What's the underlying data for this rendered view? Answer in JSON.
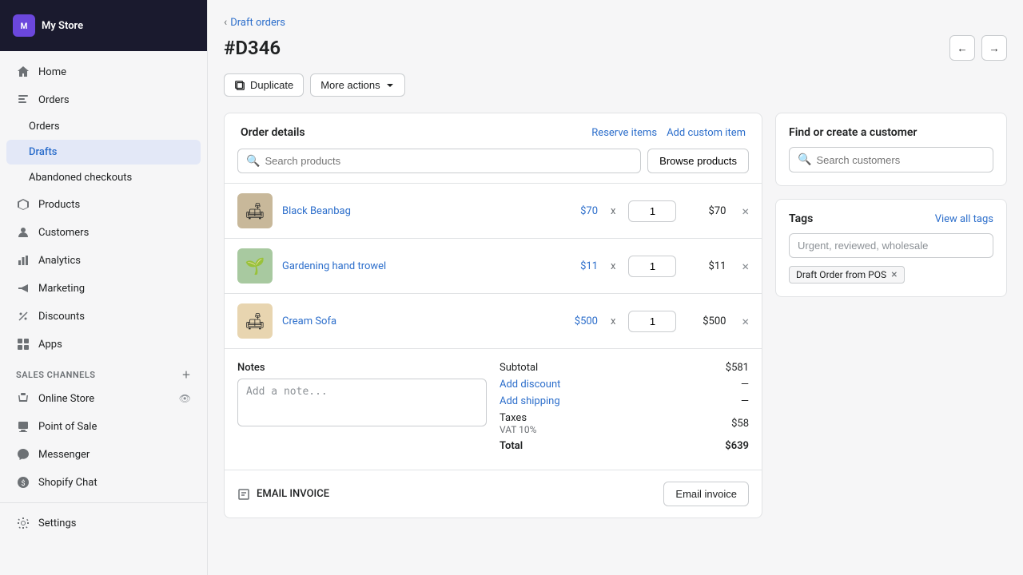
{
  "sidebar": {
    "shop": {
      "name": "My Store",
      "initial": "M"
    },
    "nav_items": [
      {
        "id": "home",
        "label": "Home",
        "icon": "home"
      },
      {
        "id": "orders",
        "label": "Orders",
        "icon": "orders"
      },
      {
        "id": "orders-sub",
        "label": "Orders",
        "icon": null,
        "sub": true
      },
      {
        "id": "drafts-sub",
        "label": "Drafts",
        "icon": null,
        "sub": true,
        "active": true
      },
      {
        "id": "abandoned-sub",
        "label": "Abandoned checkouts",
        "icon": null,
        "sub": true
      },
      {
        "id": "products",
        "label": "Products",
        "icon": "products"
      },
      {
        "id": "customers",
        "label": "Customers",
        "icon": "customers"
      },
      {
        "id": "analytics",
        "label": "Analytics",
        "icon": "analytics"
      },
      {
        "id": "marketing",
        "label": "Marketing",
        "icon": "marketing"
      },
      {
        "id": "discounts",
        "label": "Discounts",
        "icon": "discounts"
      },
      {
        "id": "apps",
        "label": "Apps",
        "icon": "apps"
      }
    ],
    "sales_channels_label": "SALES CHANNELS",
    "sales_channels": [
      {
        "id": "online-store",
        "label": "Online Store",
        "icon": "store"
      },
      {
        "id": "point-of-sale",
        "label": "Point of Sale",
        "icon": "pos"
      },
      {
        "id": "messenger",
        "label": "Messenger",
        "icon": "messenger"
      },
      {
        "id": "shopify-chat",
        "label": "Shopify Chat",
        "icon": "chat"
      }
    ],
    "settings_label": "Settings"
  },
  "page": {
    "breadcrumb": "Draft orders",
    "title": "#D346",
    "actions": {
      "duplicate": "Duplicate",
      "more_actions": "More actions"
    }
  },
  "order_details": {
    "section_title": "Order details",
    "reserve_items": "Reserve items",
    "add_custom_item": "Add custom item",
    "search_placeholder": "Search products",
    "browse_btn": "Browse products",
    "items": [
      {
        "id": "beanbag",
        "name": "Black Beanbag",
        "price": "$70",
        "quantity": "1",
        "total": "$70",
        "emoji": "🛋️"
      },
      {
        "id": "trowel",
        "name": "Gardening hand trowel",
        "price": "$11",
        "quantity": "1",
        "total": "$11",
        "emoji": "🌱"
      },
      {
        "id": "sofa",
        "name": "Cream Sofa",
        "price": "$500",
        "quantity": "1",
        "total": "$500",
        "emoji": "🛋"
      }
    ],
    "notes": {
      "label": "Notes",
      "placeholder": "Add a note..."
    },
    "add_discount": "Add discount",
    "add_shipping": "Add shipping",
    "subtotal_label": "Subtotal",
    "subtotal_value": "$581",
    "shipping_dash": "—",
    "discount_dash": "—",
    "taxes_label": "Taxes",
    "tax_detail": "VAT 10%",
    "tax_value": "$58",
    "total_label": "Total",
    "total_value": "$639"
  },
  "invoice": {
    "section_label": "EMAIL INVOICE",
    "btn_label": "Email invoice"
  },
  "customer": {
    "section_title": "Find or create a customer",
    "search_placeholder": "Search customers"
  },
  "tags": {
    "section_title": "Tags",
    "view_all": "View all tags",
    "input_placeholder": "Urgent, reviewed, wholesale",
    "chips": [
      {
        "label": "Draft Order from POS"
      }
    ]
  }
}
